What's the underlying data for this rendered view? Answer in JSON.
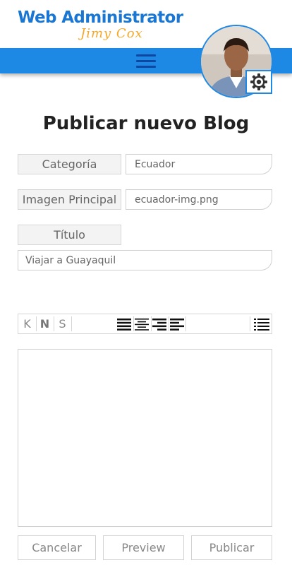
{
  "header": {
    "logo_title": "Web Administrator",
    "logo_subtitle": "Jimy Cox",
    "menu_icon": "hamburger-icon",
    "settings_icon": "gear-icon",
    "colors": {
      "brand_blue": "#1e88e5",
      "logo_blue": "#1976d2",
      "accent_orange": "#f4a82a"
    }
  },
  "page": {
    "title": "Publicar nuevo Blog"
  },
  "form": {
    "category": {
      "label": "Categoría",
      "value": "Ecuador"
    },
    "image": {
      "label": "Imagen Principal",
      "value": "ecuador-img.png"
    },
    "title_field": {
      "label": "Título",
      "value": "Viajar a Guayaquil"
    }
  },
  "toolbar": {
    "italic": "K",
    "bold": "N",
    "underline": "S",
    "align_icons": [
      "justify-icon",
      "align-center-icon",
      "align-right-icon",
      "align-left-icon"
    ],
    "list_icon": "list-icon"
  },
  "editor": {
    "content": ""
  },
  "actions": {
    "cancel": "Cancelar",
    "preview": "Preview",
    "publish": "Publicar"
  }
}
